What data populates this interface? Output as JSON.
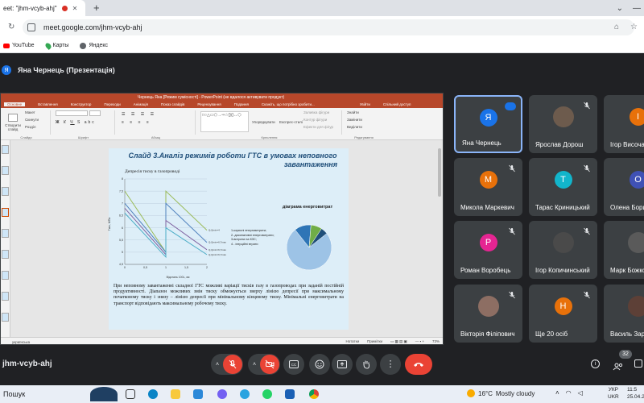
{
  "browser": {
    "tab_title": "eet: \"jhm-vcyb-ahj\"",
    "url": "meet.google.com/jhm-vcyb-ahj",
    "bookmarks": [
      {
        "label": "YouTube",
        "icon": "youtube-icon"
      },
      {
        "label": "Карты",
        "icon": "maps-icon"
      },
      {
        "label": "Яндекс",
        "icon": "yandex-icon"
      }
    ]
  },
  "meet": {
    "presenter_initial": "Я",
    "presenter_label": "Яна Чернець (Презентація)",
    "meeting_code": "jhm-vcyb-ahj",
    "people_count": "32"
  },
  "powerpoint": {
    "window_title": "Чернець Яна [Режим сумісності] - PowerPoint (не вдалося активувати продукт)",
    "tabs": [
      "Вставлення",
      "Конструктор",
      "Переходи",
      "Анімація",
      "Показ слайдів",
      "Рецензування",
      "Подання",
      "Скажіть, що потрібно зробити...",
      "Увійти",
      "Спільний доступ"
    ],
    "active_tab": "Основне",
    "ribbon_groups": [
      "Слайди",
      "Шрифт",
      "Абзац",
      "Креслення",
      "Редагування"
    ],
    "ribbon_buttons": {
      "new_slide": "Створити слайд",
      "layout": "Макет",
      "reset": "Скинути",
      "section": "Розділ",
      "arrange": "Упорядкувати",
      "quick_styles": "Експрес-стилі",
      "shape_fill": "Заливка фігури",
      "shape_outline": "Контур фігури",
      "shape_effects": "Ефекти для фігур",
      "find": "Знайти",
      "replace": "Замінити",
      "select": "Виділити"
    },
    "status": {
      "language": "українська",
      "notes": "Нотатки",
      "comments": "Примітки",
      "zoom": "73%"
    }
  },
  "slide": {
    "title_line1": "Слайд 3.Аналіз режимів роботи  ГТС в умовах неповного",
    "title_line2": "завантаження",
    "chart_heading": "Депресія тиску в газопроводі",
    "pie_heading": "діаграма енерговитрат",
    "pie_legend": [
      "1-корисні енерговитрати;",
      "2- дисипативні енерговитрати;",
      "3-витрати на КЗС;",
      "4 - інерційні втрати"
    ],
    "body_text": "При неповному завантаженні складної ГТС можливі варіації тисків газу в газопроводах при заданій постійній продуктивності. Діапазон можливих змін тиску обмежується зверху лінією депресії при максимальному початковому тиску і знизу – лінією депресії при мінімальному кінцевому тиску. Мінімальні енерговитрати на транспорт відповідають максимальному робочому тиску."
  },
  "chart_data": [
    {
      "type": "line",
      "title": "Депресія тиску в газопроводі",
      "xlabel": "Відстань 100L, км",
      "ylabel": "Тиск, МПа",
      "xlim": [
        0,
        2
      ],
      "ylim": [
        4.5,
        8
      ],
      "xticks": [
        "0",
        "0,5",
        "1",
        "1,5",
        "2"
      ],
      "yticks": [
        "4,5",
        "5",
        "5,5",
        "6",
        "6,5",
        "7",
        "7,5",
        "8"
      ],
      "series": [
        {
          "name": "Q,Qmin=4",
          "x": [
            0,
            1,
            1,
            2
          ],
          "y": [
            7.5,
            5.0,
            7.5,
            5.9
          ]
        },
        {
          "name": "Q,Qmin=6,7max",
          "x": [
            0,
            1,
            1,
            2
          ],
          "y": [
            7.0,
            5.0,
            7.0,
            5.4
          ]
        },
        {
          "name": "Q,Qmin=6,7max",
          "x": [
            0,
            1,
            1,
            2
          ],
          "y": [
            6.8,
            4.9,
            6.3,
            5.1
          ]
        },
        {
          "name": "Q,Qmin=6,7max",
          "x": [
            0,
            1,
            1,
            2
          ],
          "y": [
            6.6,
            4.8,
            6.0,
            4.9
          ]
        }
      ],
      "colors": [
        "#9bbb59",
        "#4f81bd",
        "#8064a2",
        "#4bacc6"
      ]
    },
    {
      "type": "pie",
      "title": "діаграма енерговитрат",
      "categories": [
        "1",
        "2",
        "3",
        "4"
      ],
      "values": [
        75,
        12,
        8,
        5
      ],
      "colors": [
        "#9dc3e6",
        "#2e75b6",
        "#70ad47",
        "#1f4e79"
      ]
    }
  ],
  "participants": [
    {
      "name": "Яна Чернець",
      "initial": "Я",
      "color": "#1a73e8",
      "selected": true,
      "photo": false
    },
    {
      "name": "Ярослав Дорош",
      "initial": "",
      "color": "#6d5b4d",
      "selected": false,
      "photo": true
    },
    {
      "name": "Ігор Височан",
      "initial": "І",
      "color": "#e8710a",
      "selected": false,
      "photo": false
    },
    {
      "name": "",
      "initial": "",
      "color": "",
      "selected": false,
      "photo": false
    },
    {
      "name": "Микола Маркевич",
      "initial": "М",
      "color": "#e8710a",
      "selected": false,
      "photo": false
    },
    {
      "name": "Тарас Криницький",
      "initial": "Т",
      "color": "#12b5cb",
      "selected": false,
      "photo": false
    },
    {
      "name": "Олена Борисюк",
      "initial": "О",
      "color": "#3f51b5",
      "selected": false,
      "photo": false
    },
    {
      "name": "",
      "initial": "",
      "color": "",
      "selected": false,
      "photo": false
    },
    {
      "name": "Роман Воробець",
      "initial": "Р",
      "color": "#e52592",
      "selected": false,
      "photo": false
    },
    {
      "name": "Ігор Копичинський",
      "initial": "",
      "color": "#4a4a4a",
      "selected": false,
      "photo": true
    },
    {
      "name": "Марк Божко",
      "initial": "",
      "color": "#5a5a5a",
      "selected": false,
      "photo": true
    },
    {
      "name": "",
      "initial": "",
      "color": "",
      "selected": false,
      "photo": false
    },
    {
      "name": "Вікторія Філіпович",
      "initial": "",
      "color": "#8d6e63",
      "selected": false,
      "photo": true
    },
    {
      "name": "Ще 20 осіб",
      "initial": "Н",
      "color": "#e8710a",
      "selected": false,
      "photo": false
    },
    {
      "name": "Василь Зарічний",
      "initial": "",
      "color": "#5d4037",
      "selected": false,
      "photo": true
    }
  ],
  "taskbar": {
    "search": "Пошук",
    "weather_temp": "16°C",
    "weather_text": "Mostly cloudy",
    "lang_top": "УКР",
    "lang_bottom": "UKR",
    "time": "11:5",
    "date": "25.04.2"
  }
}
